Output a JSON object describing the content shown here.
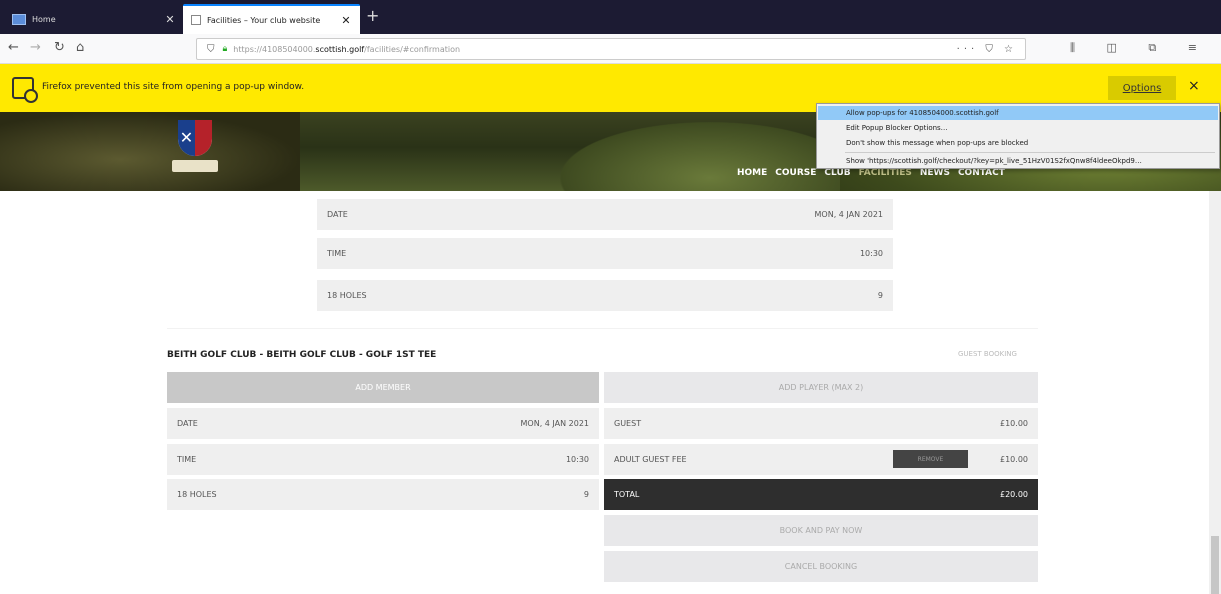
{
  "browser": {
    "tabs": [
      {
        "title": "Home"
      },
      {
        "title": "Facilities – Your club website"
      }
    ],
    "new_tab_symbol": "+",
    "url_prefix": "https://4108504000.",
    "url_domain": "scottish.golf",
    "url_path": "/facilities/#confirmation",
    "url_right_icons": "··· ⛉ ☆",
    "toolbar_icons": "⫼ ◫ ⧉ ≡"
  },
  "notification": {
    "message": "Firefox prevented this site from opening a pop-up window.",
    "options_label": "Options",
    "close_symbol": "×"
  },
  "popup_menu": {
    "items": [
      "Allow pop-ups for 4108504000.scottish.golf",
      "Edit Popup Blocker Options…",
      "Don't show this message when pop-ups are blocked",
      "Show 'https://scottish.golf/checkout/?key=pk_live_51HzV01S2fxQnw8f4ldeeOkpd9…"
    ]
  },
  "site_nav": [
    "HOME",
    "COURSE",
    "CLUB",
    "FACILITIES",
    "NEWS",
    "CONTACT"
  ],
  "summary": {
    "rows": [
      {
        "label": "DATE",
        "value": "MON, 4 JAN 2021"
      },
      {
        "label": "TIME",
        "value": "10:30"
      },
      {
        "label": "18 HOLES",
        "value": "9"
      }
    ]
  },
  "booking": {
    "heading": "BEITH GOLF CLUB - BEITH GOLF CLUB - GOLF 1ST TEE",
    "tag": "GUEST BOOKING",
    "add_member": "ADD MEMBER",
    "add_player": "ADD PLAYER (MAX 2)",
    "left_rows": [
      {
        "label": "DATE",
        "value": "MON, 4 JAN 2021"
      },
      {
        "label": "TIME",
        "value": "10:30"
      },
      {
        "label": "18 HOLES",
        "value": "9"
      }
    ],
    "right_rows": [
      {
        "label": "GUEST",
        "value": "£10.00"
      },
      {
        "label": "ADULT GUEST FEE",
        "value": "£10.00",
        "action": "REMOVE"
      }
    ],
    "total_label": "TOTAL",
    "total_value": "£20.00",
    "book_pay": "BOOK AND PAY NOW",
    "cancel": "CANCEL BOOKING"
  }
}
